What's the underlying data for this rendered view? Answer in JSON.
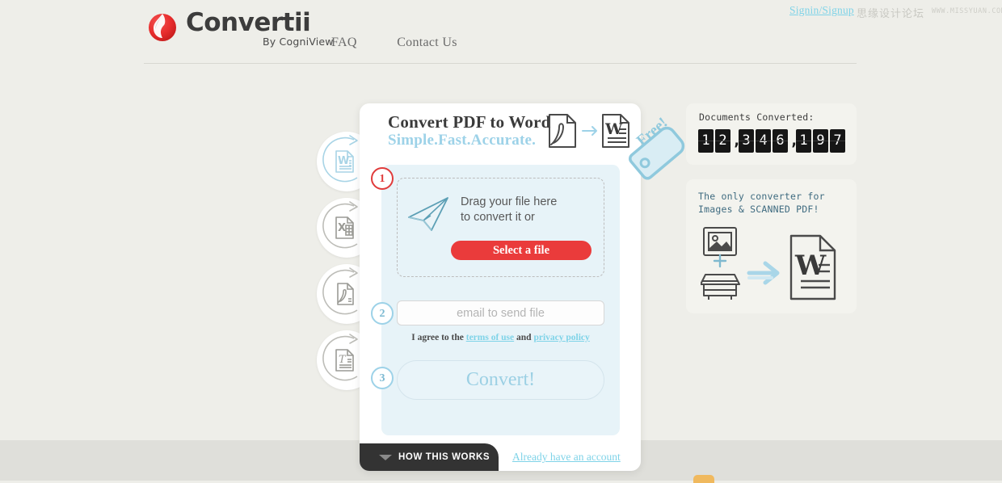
{
  "header": {
    "logo_text": "Convertii",
    "logo_sub": "By CogniView",
    "nav": [
      {
        "label": "FAQ"
      },
      {
        "label": "Contact Us"
      }
    ],
    "signin_label": "Signin/Signup",
    "watermark_cn": "思缘设计论坛",
    "watermark_en": "WWW.MISSYUAN.COM"
  },
  "format_tabs": [
    {
      "name": "word",
      "glyph": "W",
      "active": true
    },
    {
      "name": "excel",
      "glyph": "X",
      "active": false
    },
    {
      "name": "pdf",
      "glyph": "",
      "active": false
    },
    {
      "name": "text",
      "glyph": "T",
      "active": false
    }
  ],
  "card": {
    "title": "Convert PDF to Word",
    "subtitle": "Simple.Fast.Accurate.",
    "free_tag": "Free!",
    "step1": {
      "number": "1",
      "drop_text_line1": "Drag your file here",
      "drop_text_line2": "to convert it or",
      "select_button": "Select a file"
    },
    "step2": {
      "number": "2",
      "email_placeholder": "email to send file",
      "email_value": "",
      "agree_prefix": "I agree to the ",
      "agree_terms": "terms of use",
      "agree_mid": " and ",
      "agree_privacy": "privacy policy"
    },
    "step3": {
      "number": "3",
      "convert_button": "Convert!"
    },
    "footer": {
      "how_this_works": "HOW THIS WORKS",
      "account_link": "Already have an account"
    }
  },
  "counter_panel": {
    "title": "Documents Converted:",
    "digits": [
      "1",
      "2",
      ",",
      "3",
      "4",
      "6",
      ",",
      "1",
      "9",
      "7"
    ],
    "value": "12,346,197"
  },
  "info_panel": {
    "line1": "The only converter for",
    "line2": "Images & SCANNED PDF!"
  },
  "colors": {
    "page_bg": "#eeeee9",
    "page_bg_bottom": "#dfdfda",
    "accent_red": "#ea3b3b",
    "accent_blue": "#9dd2e8",
    "panel_blue": "#e7f3f8",
    "link_blue": "#7fd3e8",
    "dark": "#333333"
  }
}
